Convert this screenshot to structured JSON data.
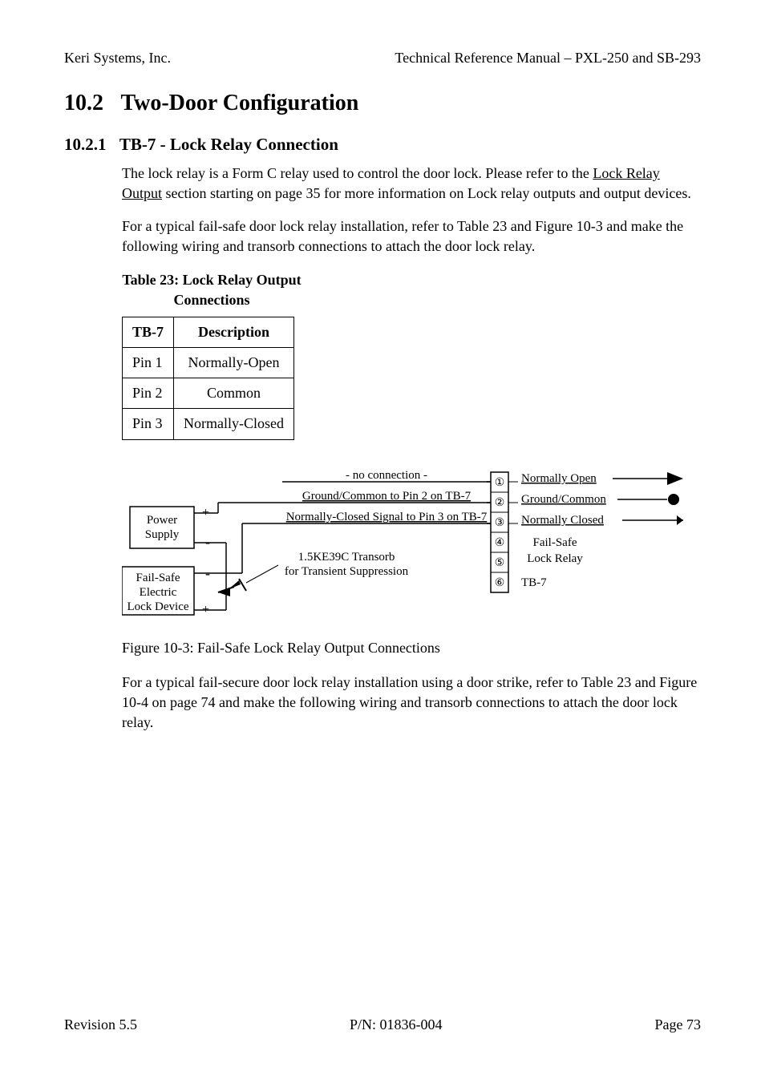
{
  "header": {
    "company": "Keri Systems, Inc.",
    "doc_title": "Technical Reference Manual – PXL-250 and SB-293"
  },
  "section": {
    "number": "10.2",
    "title": "Two-Door Configuration"
  },
  "subsection": {
    "number": "10.2.1",
    "title": "TB-7 - Lock Relay Connection"
  },
  "para1_a": "The lock relay is a Form C relay used to control the door lock. Please refer to the ",
  "para1_link": "Lock Relay Output",
  "para1_b": " section starting on page 35 for more information on Lock relay outputs and output devices.",
  "para2": "For a typical fail-safe door lock relay installation, refer to Table 23 and Figure 10-3 and make the following wiring and transorb connections to attach the door lock relay.",
  "table": {
    "caption": "Table 23: Lock Relay Output Connections",
    "col1_header": "TB-7",
    "col2_header": "Description",
    "rows": [
      {
        "pin": "Pin 1",
        "desc": "Normally-Open"
      },
      {
        "pin": "Pin 2",
        "desc": "Common"
      },
      {
        "pin": "Pin 3",
        "desc": "Normally-Closed"
      }
    ]
  },
  "figure": {
    "power_supply": "Power\nSupply",
    "power_plus": "+",
    "power_minus": "-",
    "lock_device": "Fail-Safe\nElectric\nLock Device",
    "lock_plus": "+",
    "lock_minus": "-",
    "wire_no_connection": "- no connection -",
    "wire_gnd_common": "Ground/Common to Pin 2 on TB-7",
    "wire_nc_signal": "Normally-Closed Signal to Pin 3 on TB-7",
    "transorb_line1": "1.5KE39C Transorb",
    "transorb_line2": "for Transient Suppression",
    "tb_labels": {
      "pin1": "①",
      "pin2": "②",
      "pin3": "③",
      "pin4": "④",
      "pin5": "⑤",
      "pin6": "⑥"
    },
    "right_labels": {
      "no": "Normally Open",
      "gc": "Ground/Common",
      "nc": "Normally Closed",
      "fs1": "Fail-Safe",
      "fs2": "Lock Relay",
      "tb7": "TB-7"
    },
    "caption": "Figure 10-3: Fail-Safe Lock Relay Output Connections"
  },
  "para3": "For a typical fail-secure door lock relay installation using a door strike, refer to Table 23 and Figure 10-4 on page 74 and make the following wiring and transorb connections to attach the door lock relay.",
  "footer": {
    "revision": "Revision 5.5",
    "pn": "P/N: 01836-004",
    "page": "Page 73"
  }
}
